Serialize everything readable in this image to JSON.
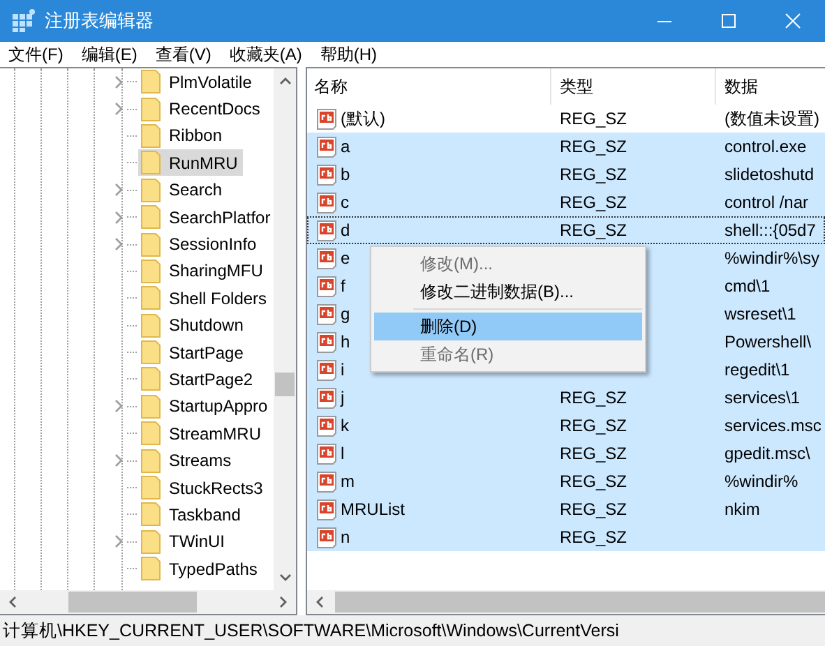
{
  "window": {
    "title": "注册表编辑器"
  },
  "menu": [
    "文件(F)",
    "编辑(E)",
    "查看(V)",
    "收藏夹(A)",
    "帮助(H)"
  ],
  "tree": {
    "items": [
      {
        "label": "PlmVolatile",
        "expandable": true,
        "selected": false
      },
      {
        "label": "RecentDocs",
        "expandable": true,
        "selected": false
      },
      {
        "label": "Ribbon",
        "expandable": false,
        "selected": false
      },
      {
        "label": "RunMRU",
        "expandable": false,
        "selected": true
      },
      {
        "label": "Search",
        "expandable": true,
        "selected": false
      },
      {
        "label": "SearchPlatfor",
        "expandable": true,
        "selected": false
      },
      {
        "label": "SessionInfo",
        "expandable": true,
        "selected": false
      },
      {
        "label": "SharingMFU",
        "expandable": false,
        "selected": false
      },
      {
        "label": "Shell Folders",
        "expandable": false,
        "selected": false
      },
      {
        "label": "Shutdown",
        "expandable": false,
        "selected": false
      },
      {
        "label": "StartPage",
        "expandable": false,
        "selected": false
      },
      {
        "label": "StartPage2",
        "expandable": false,
        "selected": false
      },
      {
        "label": "StartupAppro",
        "expandable": true,
        "selected": false
      },
      {
        "label": "StreamMRU",
        "expandable": false,
        "selected": false
      },
      {
        "label": "Streams",
        "expandable": true,
        "selected": false
      },
      {
        "label": "StuckRects3",
        "expandable": false,
        "selected": false
      },
      {
        "label": "Taskband",
        "expandable": false,
        "selected": false
      },
      {
        "label": "TWinUI",
        "expandable": true,
        "selected": false
      },
      {
        "label": "TypedPaths",
        "expandable": false,
        "selected": false
      }
    ]
  },
  "table": {
    "columns": [
      "名称",
      "类型",
      "数据"
    ],
    "rows": [
      {
        "name": "(默认)",
        "type": "REG_SZ",
        "data": "(数值未设置)",
        "selected": false,
        "focused": false
      },
      {
        "name": "a",
        "type": "REG_SZ",
        "data": "control.exe",
        "selected": true,
        "focused": false
      },
      {
        "name": "b",
        "type": "REG_SZ",
        "data": "slidetoshutd",
        "selected": true,
        "focused": false
      },
      {
        "name": "c",
        "type": "REG_SZ",
        "data": "control /nar",
        "selected": true,
        "focused": false
      },
      {
        "name": "d",
        "type": "REG_SZ",
        "data": "shell:::{05d7",
        "selected": true,
        "focused": true
      },
      {
        "name": "e",
        "data": "%windir%\\sy",
        "selected": true,
        "focused": false
      },
      {
        "name": "f",
        "data": "cmd\\1",
        "selected": true,
        "focused": false
      },
      {
        "name": "g",
        "data": "wsreset\\1",
        "selected": true,
        "focused": false
      },
      {
        "name": "h",
        "data": "Powershell\\",
        "selected": true,
        "focused": false
      },
      {
        "name": "i",
        "data": "regedit\\1",
        "selected": true,
        "focused": false
      },
      {
        "name": "j",
        "type": "REG_SZ",
        "data": "services\\1",
        "selected": true,
        "focused": false
      },
      {
        "name": "k",
        "type": "REG_SZ",
        "data": "services.msc",
        "selected": true,
        "focused": false
      },
      {
        "name": "l",
        "type": "REG_SZ",
        "data": "gpedit.msc\\",
        "selected": true,
        "focused": false
      },
      {
        "name": "m",
        "type": "REG_SZ",
        "data": "%windir%",
        "selected": true,
        "focused": false
      },
      {
        "name": "MRUList",
        "type": "REG_SZ",
        "data": "nkim",
        "selected": true,
        "focused": false
      },
      {
        "name": "n",
        "type": "REG_SZ",
        "selected": true,
        "focused": false
      }
    ]
  },
  "context_menu": [
    {
      "kind": "item",
      "label": "修改(M)...",
      "disabled": true,
      "selected": false
    },
    {
      "kind": "item",
      "label": "修改二进制数据(B)...",
      "disabled": false,
      "selected": false
    },
    {
      "kind": "separator"
    },
    {
      "kind": "item",
      "label": "删除(D)",
      "disabled": false,
      "selected": true
    },
    {
      "kind": "item",
      "label": "重命名(R)",
      "disabled": true,
      "selected": false
    }
  ],
  "status_bar": "计算机\\HKEY_CURRENT_USER\\SOFTWARE\\Microsoft\\Windows\\CurrentVersi"
}
